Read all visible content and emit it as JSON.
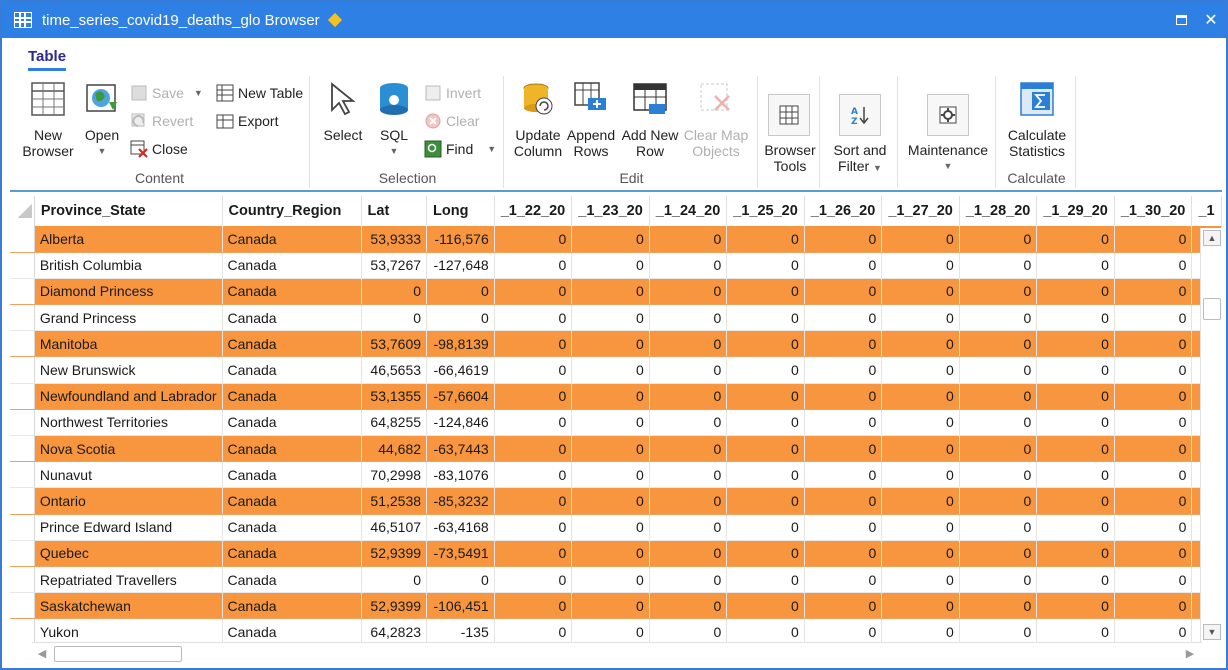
{
  "window": {
    "title": "time_series_covid19_deaths_glo Browser"
  },
  "ribbon": {
    "tab": "Table",
    "groups": {
      "content": {
        "label": "Content",
        "new_browser_l1": "New",
        "new_browser_l2": "Browser",
        "open": "Open",
        "save": "Save",
        "revert": "Revert",
        "close": "Close",
        "new_table": "New Table",
        "export": "Export"
      },
      "selection": {
        "label": "Selection",
        "select": "Select",
        "sql": "SQL",
        "invert": "Invert",
        "clear": "Clear",
        "find": "Find"
      },
      "edit": {
        "label": "Edit",
        "update_column_l1": "Update",
        "update_column_l2": "Column",
        "append_rows_l1": "Append",
        "append_rows_l2": "Rows",
        "add_new_row_l1": "Add New",
        "add_new_row_l2": "Row",
        "clear_map_objects_l1": "Clear Map",
        "clear_map_objects_l2": "Objects"
      },
      "tools": {
        "browser_tools_l1": "Browser",
        "browser_tools_l2": "Tools",
        "sort_filter_l1": "Sort and",
        "sort_filter_l2": "Filter",
        "maintenance": "Maintenance"
      },
      "calculate": {
        "label": "Calculate",
        "calc_stats_l1": "Calculate",
        "calc_stats_l2": "Statistics"
      }
    }
  },
  "table": {
    "columns": [
      "Province_State",
      "Country_Region",
      "Lat",
      "Long",
      "_1_22_20",
      "_1_23_20",
      "_1_24_20",
      "_1_25_20",
      "_1_26_20",
      "_1_27_20",
      "_1_28_20",
      "_1_29_20",
      "_1_30_20",
      "_1"
    ],
    "rows": [
      {
        "province": "Alberta",
        "country": "Canada",
        "lat": "53,9333",
        "long": "-116,576",
        "vals": [
          "0",
          "0",
          "0",
          "0",
          "0",
          "0",
          "0",
          "0",
          "0"
        ],
        "highlight": true
      },
      {
        "province": "British Columbia",
        "country": "Canada",
        "lat": "53,7267",
        "long": "-127,648",
        "vals": [
          "0",
          "0",
          "0",
          "0",
          "0",
          "0",
          "0",
          "0",
          "0"
        ],
        "highlight": false
      },
      {
        "province": "Diamond Princess",
        "country": "Canada",
        "lat": "0",
        "long": "0",
        "vals": [
          "0",
          "0",
          "0",
          "0",
          "0",
          "0",
          "0",
          "0",
          "0"
        ],
        "highlight": true
      },
      {
        "province": "Grand Princess",
        "country": "Canada",
        "lat": "0",
        "long": "0",
        "vals": [
          "0",
          "0",
          "0",
          "0",
          "0",
          "0",
          "0",
          "0",
          "0"
        ],
        "highlight": false
      },
      {
        "province": "Manitoba",
        "country": "Canada",
        "lat": "53,7609",
        "long": "-98,8139",
        "vals": [
          "0",
          "0",
          "0",
          "0",
          "0",
          "0",
          "0",
          "0",
          "0"
        ],
        "highlight": true
      },
      {
        "province": "New Brunswick",
        "country": "Canada",
        "lat": "46,5653",
        "long": "-66,4619",
        "vals": [
          "0",
          "0",
          "0",
          "0",
          "0",
          "0",
          "0",
          "0",
          "0"
        ],
        "highlight": false
      },
      {
        "province": "Newfoundland and Labrador",
        "country": "Canada",
        "lat": "53,1355",
        "long": "-57,6604",
        "vals": [
          "0",
          "0",
          "0",
          "0",
          "0",
          "0",
          "0",
          "0",
          "0"
        ],
        "highlight": true
      },
      {
        "province": "Northwest Territories",
        "country": "Canada",
        "lat": "64,8255",
        "long": "-124,846",
        "vals": [
          "0",
          "0",
          "0",
          "0",
          "0",
          "0",
          "0",
          "0",
          "0"
        ],
        "highlight": false
      },
      {
        "province": "Nova Scotia",
        "country": "Canada",
        "lat": "44,682",
        "long": "-63,7443",
        "vals": [
          "0",
          "0",
          "0",
          "0",
          "0",
          "0",
          "0",
          "0",
          "0"
        ],
        "highlight": true
      },
      {
        "province": "Nunavut",
        "country": "Canada",
        "lat": "70,2998",
        "long": "-83,1076",
        "vals": [
          "0",
          "0",
          "0",
          "0",
          "0",
          "0",
          "0",
          "0",
          "0"
        ],
        "highlight": false
      },
      {
        "province": "Ontario",
        "country": "Canada",
        "lat": "51,2538",
        "long": "-85,3232",
        "vals": [
          "0",
          "0",
          "0",
          "0",
          "0",
          "0",
          "0",
          "0",
          "0"
        ],
        "highlight": true
      },
      {
        "province": "Prince Edward Island",
        "country": "Canada",
        "lat": "46,5107",
        "long": "-63,4168",
        "vals": [
          "0",
          "0",
          "0",
          "0",
          "0",
          "0",
          "0",
          "0",
          "0"
        ],
        "highlight": false
      },
      {
        "province": "Quebec",
        "country": "Canada",
        "lat": "52,9399",
        "long": "-73,5491",
        "vals": [
          "0",
          "0",
          "0",
          "0",
          "0",
          "0",
          "0",
          "0",
          "0"
        ],
        "highlight": true
      },
      {
        "province": "Repatriated Travellers",
        "country": "Canada",
        "lat": "0",
        "long": "0",
        "vals": [
          "0",
          "0",
          "0",
          "0",
          "0",
          "0",
          "0",
          "0",
          "0"
        ],
        "highlight": false
      },
      {
        "province": "Saskatchewan",
        "country": "Canada",
        "lat": "52,9399",
        "long": "-106,451",
        "vals": [
          "0",
          "0",
          "0",
          "0",
          "0",
          "0",
          "0",
          "0",
          "0"
        ],
        "highlight": true
      },
      {
        "province": "Yukon",
        "country": "Canada",
        "lat": "64,2823",
        "long": "-135",
        "vals": [
          "0",
          "0",
          "0",
          "0",
          "0",
          "0",
          "0",
          "0",
          "0"
        ],
        "highlight": false
      }
    ]
  },
  "colors": {
    "title_bar": "#2f80e4",
    "highlight_row": "#f7963e",
    "modified_marker": "#f7c21a"
  }
}
